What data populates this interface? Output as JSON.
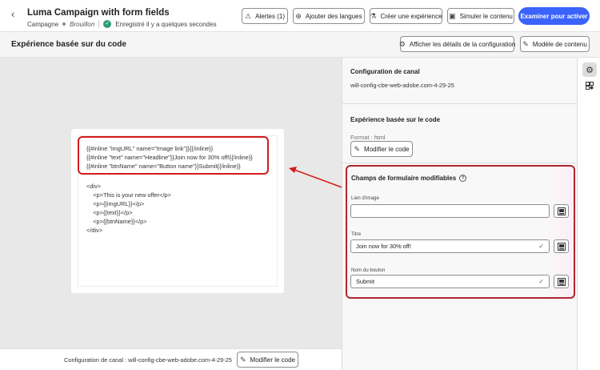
{
  "header": {
    "back_icon": "chevron-left-icon",
    "title": "Luma Campaign with form fields",
    "type": "Campagne",
    "status": "Brouillon",
    "saved": "Enregistré il y a quelques secondes"
  },
  "toolbar": {
    "alerts_label": "Alertes (1)",
    "add_languages_label": "Ajouter des langues",
    "create_experiment_label": "Créer une expérience",
    "simulate_label": "Simuler le contenu",
    "review_label": "Examiner pour activer"
  },
  "subheader": {
    "title": "Expérience basée sur du code",
    "show_config_label": "Afficher les détails de la configuration",
    "content_template_label": "Modèle de contenu"
  },
  "editor": {
    "inline_lines": [
      "{{#inline \"imgURL\" name=\"Image link\"}}{{/inline}}",
      "{{#inline \"text\" name=\"Headline\"}}Join now for 30% off!{{/inline}}",
      "{{#inline \"btnName\" name=\"Button name\"}}Submit{{/inline}}"
    ],
    "body_lines": [
      "<div>",
      "    <p>This is your new offer</p>",
      "    <p>{{imgURL}}</p>",
      "    <p>{{text}}</p>",
      "    <p>{{btnName}}</p>",
      "</div>"
    ]
  },
  "footer": {
    "channel_config": "Configuration de canal : will-config-cbe-web-adobe.com-4-29-25",
    "edit_content_label": "Modifier le code"
  },
  "right_panel": {
    "channel_config_title": "Configuration de canal",
    "channel_config_value": "will-config-cbe-web-adobe.com-4-29-25",
    "code_experience_title": "Expérience basée sur le code",
    "format": "Format : html",
    "edit_code_label": "Modifier le code",
    "form_title": "Champs de formulaire modifiables",
    "fields": [
      {
        "label": "Lien d'image",
        "value": ""
      },
      {
        "label": "Titre",
        "value": "Join now for 30% off!"
      },
      {
        "label": "Nom du bouton",
        "value": "Submit"
      }
    ]
  },
  "colors": {
    "accent": "#3b63fb",
    "highlight": "#d31b1b",
    "success": "#2d9d78"
  }
}
